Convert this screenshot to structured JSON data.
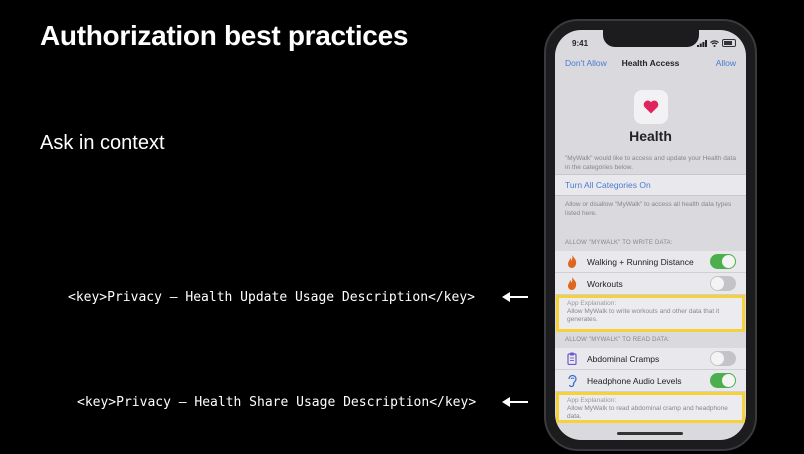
{
  "slide": {
    "title": "Authorization best practices",
    "subtitle": "Ask in context",
    "code_update": "<key>Privacy – Health Update Usage Description</key>",
    "code_share": "<key>Privacy – Health Share Usage Description</key>"
  },
  "phone": {
    "status": {
      "time": "9:41"
    },
    "navbar": {
      "left": "Don't Allow",
      "title": "Health Access",
      "right": "Allow"
    },
    "app": {
      "icon": "heart-icon",
      "name": "Health",
      "accent": "#e0245e"
    },
    "intro": "\"MyWalk\" would like to access and update your Health data in the categories below.",
    "turn_all": "Turn All Categories On",
    "allow_text": "Allow or disallow \"MyWalk\" to access all health data types listed here.",
    "write_section": {
      "header": "ALLOW \"MYWALK\" TO WRITE DATA:",
      "items": [
        {
          "label": "Walking + Running Distance",
          "icon": "flame-icon",
          "on": true
        },
        {
          "label": "Workouts",
          "icon": "flame-icon",
          "on": false
        }
      ],
      "explanation_head": "App Explanation:",
      "explanation": "Allow MyWalk to write workouts and other data that it generates."
    },
    "read_section": {
      "header": "ALLOW \"MYWALK\" TO READ DATA:",
      "items": [
        {
          "label": "Abdominal Cramps",
          "icon": "clipboard-icon",
          "on": false
        },
        {
          "label": "Headphone Audio Levels",
          "icon": "ear-icon",
          "on": true
        }
      ],
      "explanation_head": "App Explanation:",
      "explanation": "Allow MyWalk to read abdominal cramp and headphone data."
    }
  },
  "colors": {
    "highlight": "#f5d23a",
    "toggle_on": "#4cae4c",
    "link": "#4a7bd0"
  }
}
